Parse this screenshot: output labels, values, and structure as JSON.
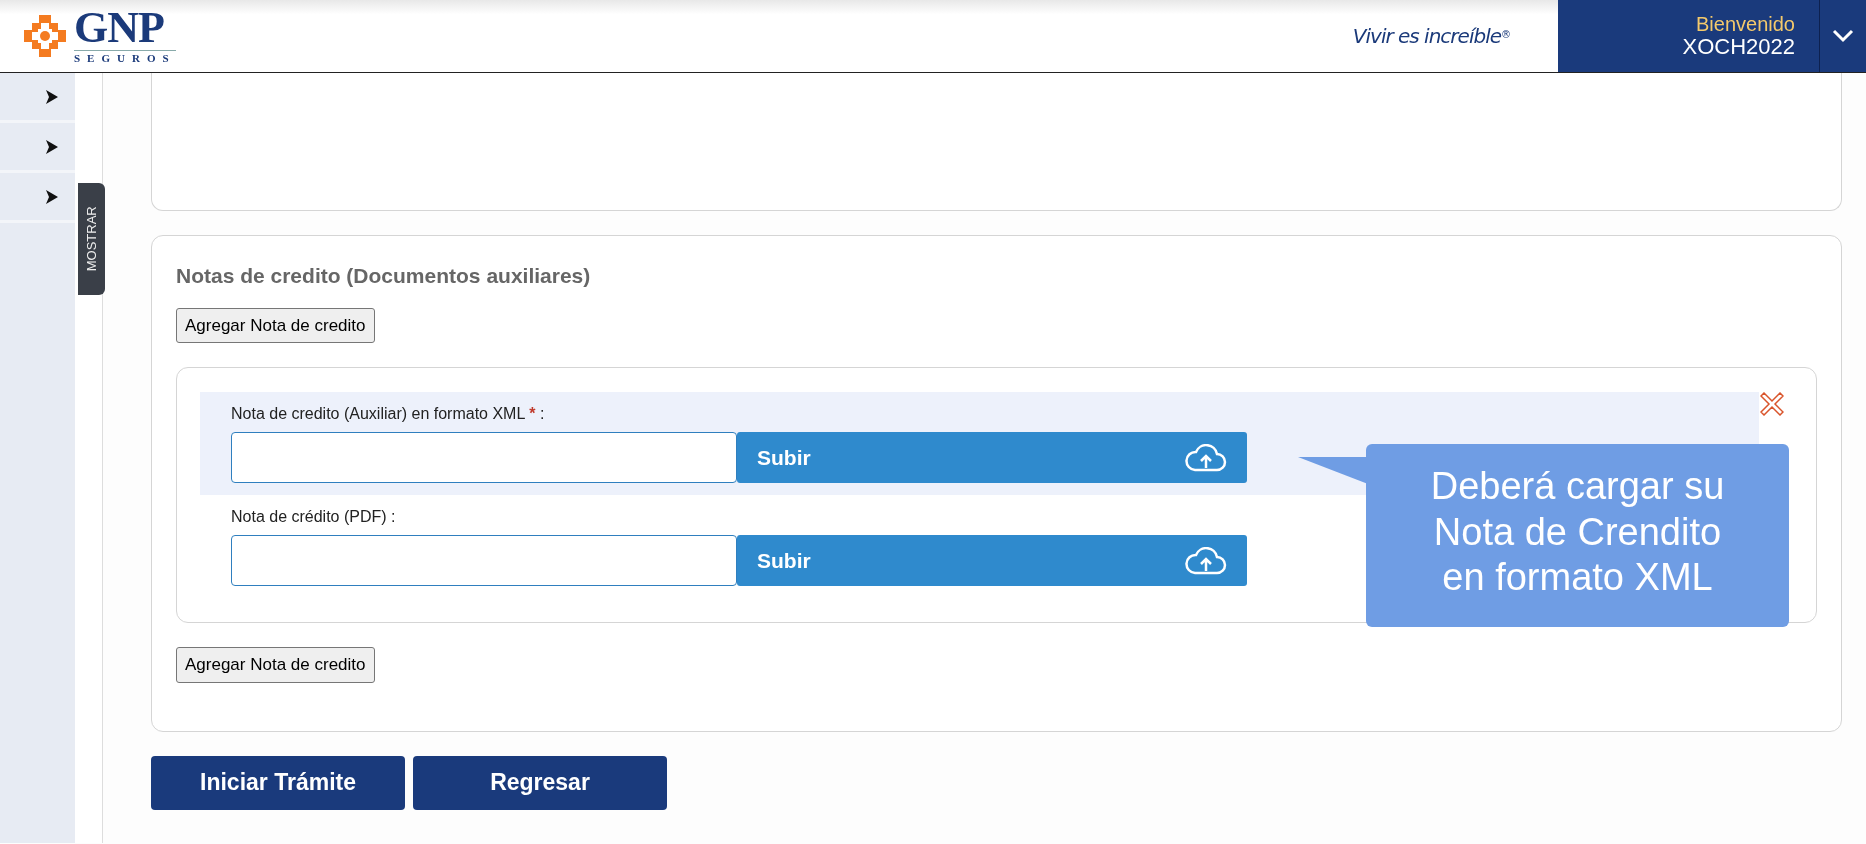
{
  "header": {
    "logo": {
      "name": "GNP",
      "subtitle": "SEGUROS"
    },
    "tagline": "Vivir es increíble",
    "tagline_mark": "®",
    "user": {
      "greeting": "Bienvenido",
      "username": "XOCH2022"
    }
  },
  "sidebar": {
    "items": [
      {
        "expanded": false
      },
      {
        "expanded": false
      },
      {
        "expanded": false
      }
    ],
    "toggle_label": "MOSTRAR"
  },
  "credit_notes": {
    "title": "Notas de credito (Documentos auxiliares)",
    "add_button": "Agregar Nota de credito",
    "entries": [
      {
        "fields": [
          {
            "label": "Nota de credito (Auxiliar) en formato XML",
            "required_mark": "*",
            "suffix": " :",
            "button": "Subir",
            "highlighted": true
          },
          {
            "label": "Nota de crédito (PDF)",
            "suffix": " :",
            "button": "Subir",
            "highlighted": false
          }
        ]
      }
    ],
    "add_button_bottom": "Agregar Nota de credito"
  },
  "callout": {
    "text": "Deberá cargar su Nota de Crendito en formato XML"
  },
  "actions": [
    "Iniciar Trámite",
    "Regresar"
  ]
}
